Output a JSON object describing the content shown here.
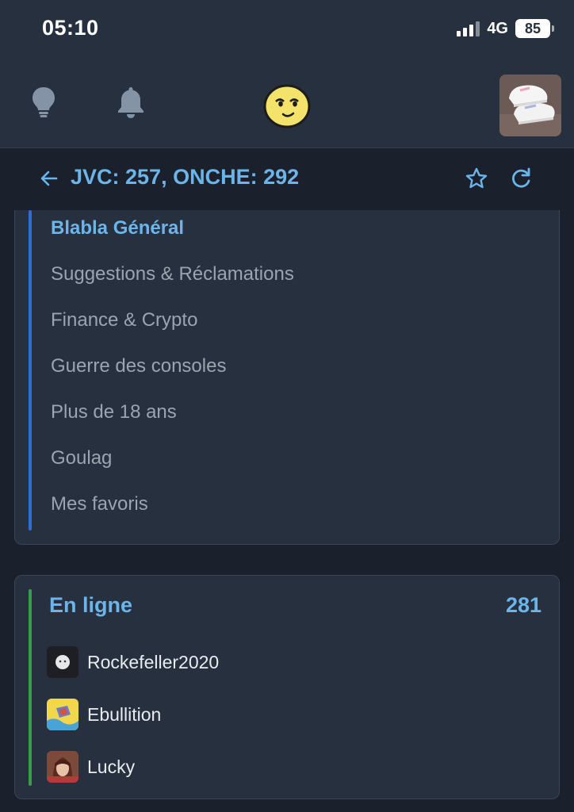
{
  "status": {
    "time": "05:10",
    "network": "4G",
    "battery": "85"
  },
  "header": {
    "icons": [
      "lightbulb-icon",
      "bell-icon",
      "mascot-smiley-icon"
    ],
    "avatar": "profile-sneaker-avatar"
  },
  "title_row": {
    "title": "JVC: 257, ONCHE: 292",
    "icons": [
      "back-arrow-icon",
      "star-icon",
      "refresh-icon"
    ]
  },
  "forums": {
    "items": [
      {
        "label": "Blabla Général",
        "active": true
      },
      {
        "label": "Suggestions & Réclamations",
        "active": false
      },
      {
        "label": "Finance & Crypto",
        "active": false
      },
      {
        "label": "Guerre des consoles",
        "active": false
      },
      {
        "label": "Plus de 18 ans",
        "active": false
      },
      {
        "label": "Goulag",
        "active": false
      },
      {
        "label": "Mes favoris",
        "active": false
      }
    ]
  },
  "online": {
    "title": "En ligne",
    "count": "281",
    "users": [
      {
        "name": "Rockefeller2020"
      },
      {
        "name": "Ebullition"
      },
      {
        "name": "Lucky"
      }
    ]
  },
  "colors": {
    "accent": "#6cb5ea",
    "background": "#1a212c",
    "card": "#26303e",
    "forum_bar": "#2f6dd1",
    "online_bar": "#3b9a4c"
  }
}
